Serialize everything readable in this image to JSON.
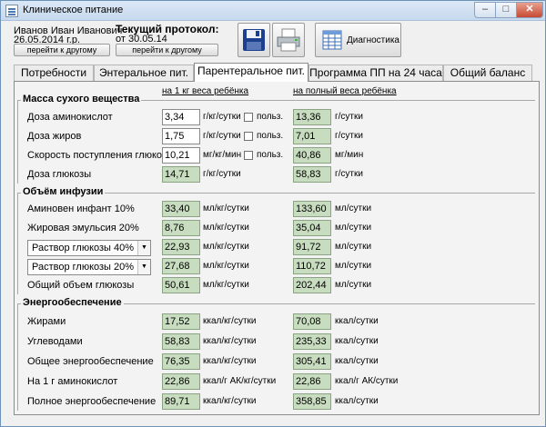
{
  "window": {
    "title": "Клиническое питание",
    "minimize": "–",
    "maximize": "□",
    "close": "✕"
  },
  "patient": {
    "name": "Иванов Иван Иванович",
    "birthdate": "26.05.2014 г.р.",
    "goto_label": "перейти к другому"
  },
  "protocol": {
    "title": "Текущий протокол:",
    "date": "от 30.05.14",
    "goto_label": "перейти к другому"
  },
  "toolbar": {
    "save_icon": "floppy-disk-icon",
    "print_icon": "printer-icon",
    "diagnostics_label": "Диагностика"
  },
  "tabs": [
    {
      "label": "Потребности"
    },
    {
      "label": "Энтеральное пит."
    },
    {
      "label": "Парентеральное пит."
    },
    {
      "label": "Программа ПП на 24 часа"
    },
    {
      "label": "Общий баланс"
    }
  ],
  "columns": {
    "per_kg": "на 1 кг веса ребёнка",
    "per_total": "на полный веса ребёнка"
  },
  "groups": {
    "dry": {
      "title": "Масса сухого вещества",
      "rows": [
        {
          "label": "Доза аминокислот",
          "v1": "3,34",
          "u1": "г/кг/сутки",
          "chk": "польз.",
          "v2": "13,36",
          "u2": "г/сутки"
        },
        {
          "label": "Доза жиров",
          "v1": "1,75",
          "u1": "г/кг/сутки",
          "chk": "польз.",
          "v2": "7,01",
          "u2": "г/сутки"
        },
        {
          "label": "Скорость поступления глюкозы",
          "v1": "10,21",
          "u1": "мг/кг/мин",
          "chk": "польз.",
          "v2": "40,86",
          "u2": "мг/мин"
        },
        {
          "label": "Доза глюкозы",
          "v1": "14,71",
          "u1": "г/кг/сутки",
          "v2": "58,83",
          "u2": "г/сутки"
        }
      ]
    },
    "infusion": {
      "title": "Объём инфузии",
      "rows": [
        {
          "label": "Аминовен инфант 10%",
          "v1": "33,40",
          "u1": "мл/кг/сутки",
          "v2": "133,60",
          "u2": "мл/сутки"
        },
        {
          "label": "Жировая эмульсия 20%",
          "v1": "8,76",
          "u1": "мл/кг/сутки",
          "v2": "35,04",
          "u2": "мл/сутки"
        },
        {
          "combo": "Раствор глюкозы 40%",
          "v1": "22,93",
          "u1": "мл/кг/сутки",
          "v2": "91,72",
          "u2": "мл/сутки"
        },
        {
          "combo": "Раствор глюкозы 20%",
          "v1": "27,68",
          "u1": "мл/кг/сутки",
          "v2": "110,72",
          "u2": "мл/сутки"
        },
        {
          "label": "Общий объем глюкозы",
          "v1": "50,61",
          "u1": "мл/кг/сутки",
          "v2": "202,44",
          "u2": "мл/сутки"
        }
      ]
    },
    "energy": {
      "title": "Энергообеспечение",
      "rows": [
        {
          "label": "Жирами",
          "v1": "17,52",
          "u1": "ккал/кг/сутки",
          "v2": "70,08",
          "u2": "ккал/сутки"
        },
        {
          "label": "Углеводами",
          "v1": "58,83",
          "u1": "ккал/кг/сутки",
          "v2": "235,33",
          "u2": "ккал/сутки"
        },
        {
          "label": "Общее энергообеспечение",
          "v1": "76,35",
          "u1": "ккал/кг/сутки",
          "v2": "305,41",
          "u2": "ккал/сутки"
        },
        {
          "label": "На 1 г аминокислот",
          "v1": "22,86",
          "u1": "ккал/г АК/кг/сутки",
          "v2": "22,86",
          "u2": "ккал/г АК/сутки"
        },
        {
          "label": "Полное энергообеспечение",
          "v1": "89,71",
          "u1": "ккал/кг/сутки",
          "v2": "358,85",
          "u2": "ккал/сутки"
        }
      ]
    }
  }
}
